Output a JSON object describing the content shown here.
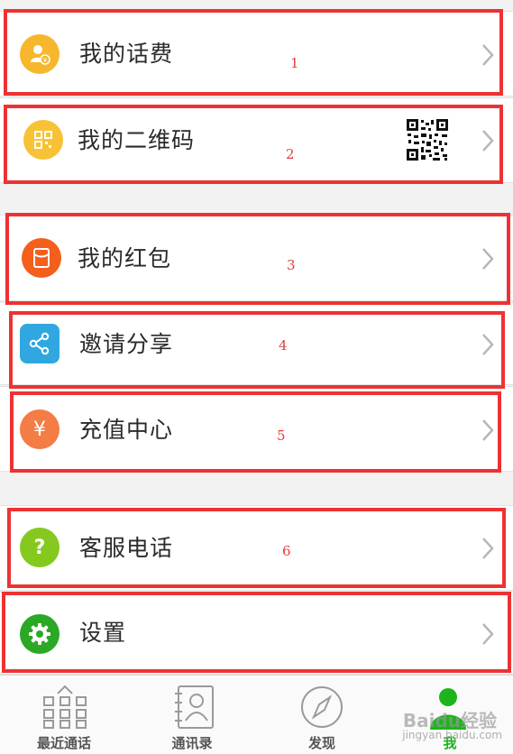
{
  "menu": {
    "phone_bill": {
      "label": "我的话费",
      "icon": "person-coin-icon",
      "color": "#f6b72c"
    },
    "qr_code": {
      "label": "我的二维码",
      "icon": "qr-grid-icon",
      "color": "#f7c235"
    },
    "red_packet": {
      "label": "我的红包",
      "icon": "red-envelope-icon",
      "color": "#f45f1b"
    },
    "invite_share": {
      "label": "邀请分享",
      "icon": "share-icon",
      "color": "#30a7e0"
    },
    "recharge": {
      "label": "充值中心",
      "icon": "yuan-icon",
      "color": "#f47c45"
    },
    "service_phone": {
      "label": "客服电话",
      "icon": "question-icon",
      "color": "#86c91e"
    },
    "settings": {
      "label": "设置",
      "icon": "gear-icon",
      "color": "#2ba826"
    }
  },
  "annotations": [
    "1",
    "2",
    "3",
    "4",
    "5",
    "6"
  ],
  "annotation_color": "#ee3233",
  "tabbar": {
    "recent_calls": "最近通话",
    "contacts": "通讯录",
    "discover": "发现",
    "me": "我"
  },
  "active_tab_color": "#1bb51b",
  "watermark": {
    "brand": "Baidu经验",
    "url": "jingyan.baidu.com"
  }
}
